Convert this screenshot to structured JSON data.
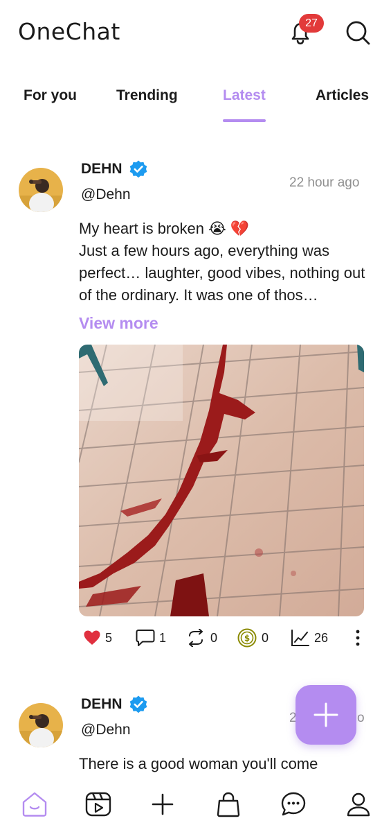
{
  "header": {
    "title": "OneChat",
    "notifications_count": "27",
    "notification_icon": "bell-icon",
    "search_icon": "search-icon"
  },
  "tabs": [
    {
      "label": "For you",
      "active": false
    },
    {
      "label": "Trending",
      "active": false
    },
    {
      "label": "Latest",
      "active": true
    },
    {
      "label": "Articles",
      "active": false
    }
  ],
  "posts": [
    {
      "author": "DEHN",
      "handle": "@Dehn",
      "time": "22 hour ago",
      "text_line1": "My heart is broken 😭 💔",
      "text_rest": "Just a few hours ago, everything was perfect… laughter, good vibes, nothing out of the ordinary. It was one of thos…",
      "view_more": "View more",
      "stats": {
        "likes": "5",
        "comments": "1",
        "reposts": "0",
        "tips": "0",
        "views": "26"
      }
    },
    {
      "author": "DEHN",
      "handle": "@Dehn",
      "time": "2",
      "time_suffix": "o",
      "text_line1": "There is a good woman you'll come"
    }
  ],
  "colors": {
    "accent": "#b48cf0",
    "badge": "#e23a3a",
    "like": "#e0303f",
    "time": "#8f8f8f",
    "verified": "#1d9bf0"
  },
  "bottom_nav": [
    "home-icon",
    "reels-icon",
    "add-icon",
    "shop-icon",
    "chat-icon",
    "profile-icon"
  ]
}
